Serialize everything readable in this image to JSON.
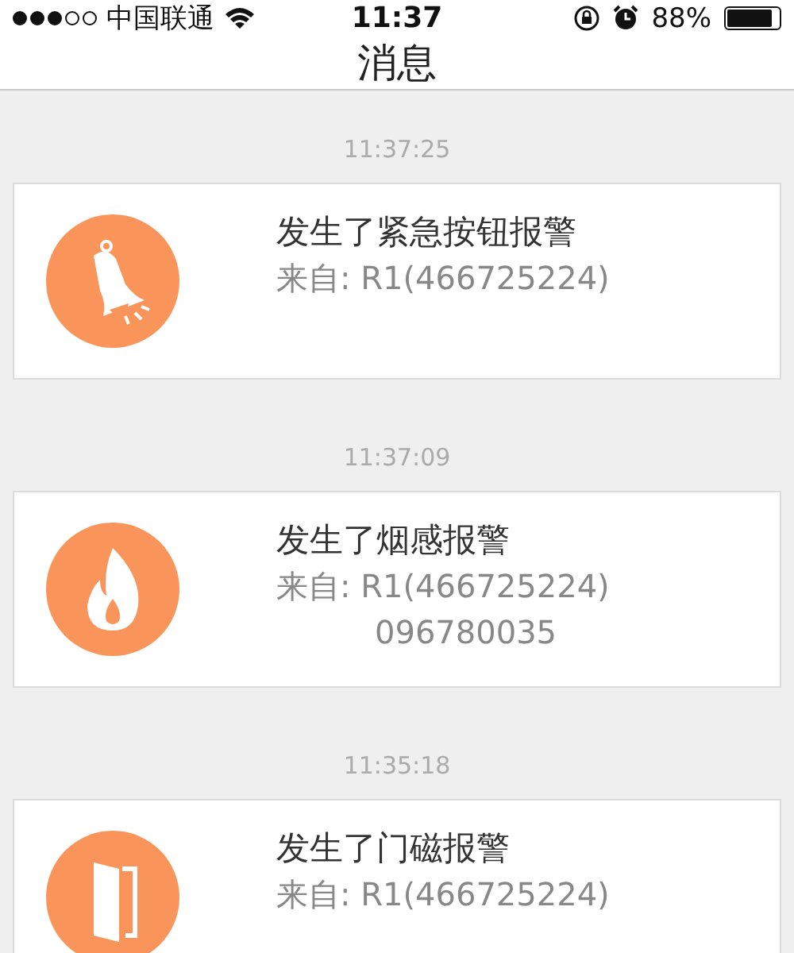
{
  "status_bar": {
    "carrier": "中国联通",
    "time": "11:37",
    "battery": "88%"
  },
  "nav": {
    "title": "消息"
  },
  "messages": [
    {
      "time": "11:37:25",
      "kind": "bell",
      "title": "发生了紧急按钮报警",
      "lines": [
        "来自: R1(466725224)"
      ]
    },
    {
      "time": "11:37:09",
      "kind": "fire",
      "title": "发生了烟感报警",
      "lines": [
        "来自: R1(466725224)",
        "096780035"
      ]
    },
    {
      "time": "11:35:18",
      "kind": "door",
      "title": "发生了门磁报警",
      "lines": [
        "来自: R1(466725224)"
      ]
    }
  ]
}
